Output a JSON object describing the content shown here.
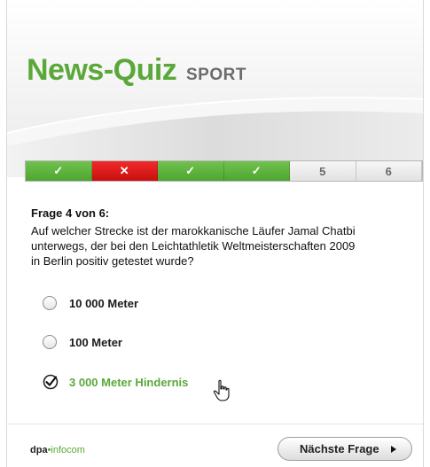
{
  "header": {
    "title": "News-Quiz",
    "subtitle": "SPORT"
  },
  "progress": [
    {
      "state": "correct",
      "label": "✓"
    },
    {
      "state": "wrong",
      "label": "✕"
    },
    {
      "state": "correct",
      "label": "✓"
    },
    {
      "state": "correct",
      "label": "✓"
    },
    {
      "state": "pending",
      "label": "5"
    },
    {
      "state": "pending",
      "label": "6"
    }
  ],
  "question": {
    "heading": "Frage 4 von 6:",
    "line1": "Auf welcher Strecke ist der marokkanische Läufer Jamal Chatbi",
    "line2": "unterwegs, der bei den Leichtathletik Weltmeisterschaften 2009",
    "line3": "in Berlin positiv getestet wurde?"
  },
  "answers": [
    {
      "label": "10 000 Meter",
      "selected": false
    },
    {
      "label": "100 Meter",
      "selected": false
    },
    {
      "label": "3 000 Meter Hindernis",
      "selected": true
    }
  ],
  "footer": {
    "brand_main": "dpa",
    "brand_dot": "•",
    "brand_rest": "infocom",
    "next_label": "Nächste Frage"
  },
  "colors": {
    "accent_green": "#5aa83a",
    "wrong_red": "#e01b1b"
  }
}
